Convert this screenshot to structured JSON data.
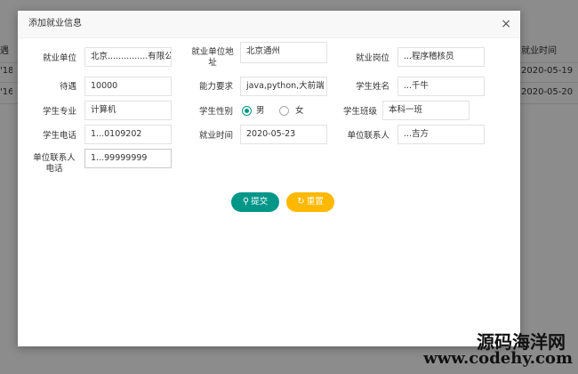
{
  "background": {
    "rows": [
      {
        "left": "遇",
        "right": "就业时间"
      },
      {
        "left": "'18",
        "right": "2020-05-19"
      },
      {
        "left": "'16",
        "right": "2020-05-20"
      }
    ]
  },
  "dialog": {
    "title": "添加就业信息",
    "close_icon": "×",
    "fields": {
      "company": {
        "label": "就业单位",
        "value": "北京...............有限公司"
      },
      "company_addr": {
        "label": "就业单位地址",
        "value": "北京通州"
      },
      "position": {
        "label": "就业岗位",
        "value": "...程序稽核员"
      },
      "salary": {
        "label": "待遇",
        "value": "10000"
      },
      "skills": {
        "label": "能力要求",
        "value": "java,python,大前端"
      },
      "student_name": {
        "label": "学生姓名",
        "value": "...千牛"
      },
      "major": {
        "label": "学生专业",
        "value": "计算机"
      },
      "gender": {
        "label": "学生性别",
        "options": [
          "男",
          "女"
        ],
        "selected": "男"
      },
      "class": {
        "label": "学生班级",
        "value": "本科一班"
      },
      "phone": {
        "label": "学生电话",
        "value": "1...0109202"
      },
      "employ_date": {
        "label": "就业时间",
        "value": "2020-05-23"
      },
      "contact": {
        "label": "单位联系人",
        "value": "...吉方"
      },
      "contact_phone": {
        "label": "单位联系人电话",
        "value": "1...99999999"
      }
    },
    "buttons": {
      "submit": {
        "label": "提交",
        "icon": "search-icon",
        "color": "#009688"
      },
      "reset": {
        "label": "重置",
        "icon": "refresh-icon",
        "color": "#ffb800"
      }
    }
  },
  "watermark": {
    "line1": "源码海洋网",
    "line2": "www.codehy.com"
  }
}
